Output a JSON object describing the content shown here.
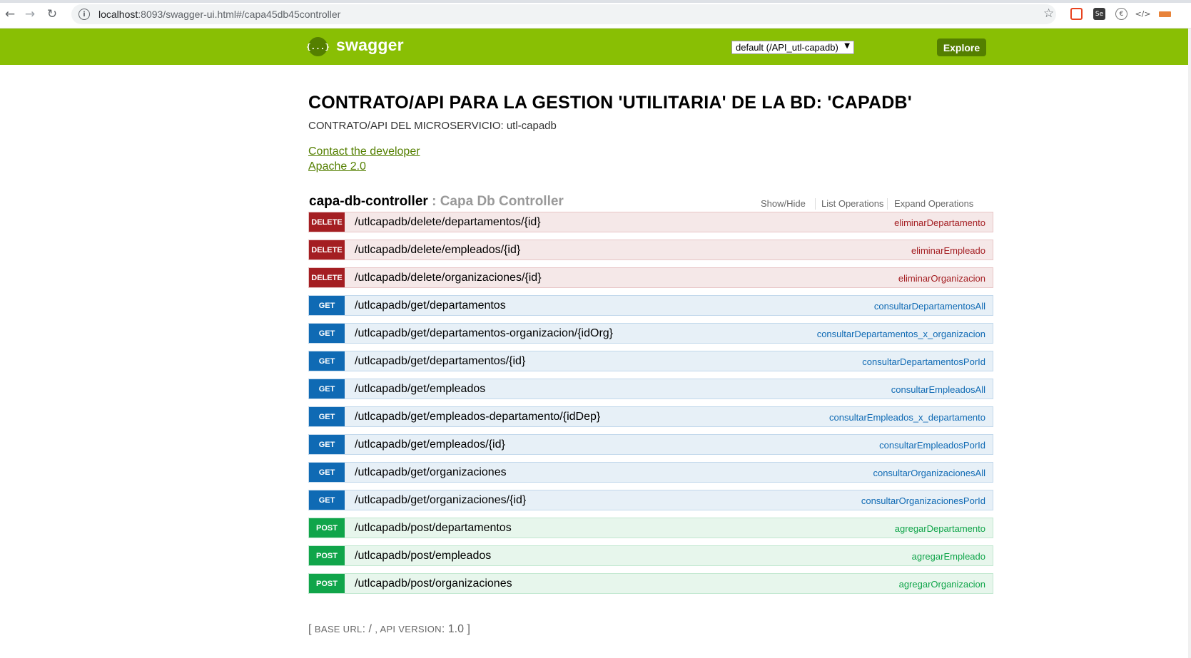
{
  "browser": {
    "url_host": "localhost",
    "url_rest": ":8093/swagger-ui.html#/capa45db45controller",
    "extensions": [
      "SE",
      "Se",
      "€",
      "</>",
      "ext"
    ]
  },
  "header": {
    "logo_text": "{...}",
    "title": "swagger",
    "api_select_value": "default (/API_utl-capadb)",
    "explore_label": "Explore"
  },
  "info": {
    "title": "CONTRATO/API PARA LA GESTION 'UTILITARIA' DE LA BD: 'CAPADB'",
    "description": "CONTRATO/API DEL MICROSERVICIO: utl-capadb",
    "contact_link": "Contact the developer",
    "license_link": "Apache 2.0"
  },
  "controller": {
    "name": "capa-db-controller",
    "separator": " : ",
    "description": "Capa Db Controller",
    "actions": [
      "Show/Hide",
      "List Operations",
      "Expand Operations"
    ]
  },
  "operations": [
    {
      "method": "DELETE",
      "path": "/utlcapadb/delete/departamentos/{id}",
      "nickname": "eliminarDepartamento"
    },
    {
      "method": "DELETE",
      "path": "/utlcapadb/delete/empleados/{id}",
      "nickname": "eliminarEmpleado"
    },
    {
      "method": "DELETE",
      "path": "/utlcapadb/delete/organizaciones/{id}",
      "nickname": "eliminarOrganizacion"
    },
    {
      "method": "GET",
      "path": "/utlcapadb/get/departamentos",
      "nickname": "consultarDepartamentosAll"
    },
    {
      "method": "GET",
      "path": "/utlcapadb/get/departamentos-organizacion/{idOrg}",
      "nickname": "consultarDepartamentos_x_organizacion"
    },
    {
      "method": "GET",
      "path": "/utlcapadb/get/departamentos/{id}",
      "nickname": "consultarDepartamentosPorId"
    },
    {
      "method": "GET",
      "path": "/utlcapadb/get/empleados",
      "nickname": "consultarEmpleadosAll"
    },
    {
      "method": "GET",
      "path": "/utlcapadb/get/empleados-departamento/{idDep}",
      "nickname": "consultarEmpleados_x_departamento"
    },
    {
      "method": "GET",
      "path": "/utlcapadb/get/empleados/{id}",
      "nickname": "consultarEmpleadosPorId"
    },
    {
      "method": "GET",
      "path": "/utlcapadb/get/organizaciones",
      "nickname": "consultarOrganizacionesAll"
    },
    {
      "method": "GET",
      "path": "/utlcapadb/get/organizaciones/{id}",
      "nickname": "consultarOrganizacionesPorId"
    },
    {
      "method": "POST",
      "path": "/utlcapadb/post/departamentos",
      "nickname": "agregarDepartamento"
    },
    {
      "method": "POST",
      "path": "/utlcapadb/post/empleados",
      "nickname": "agregarEmpleado"
    },
    {
      "method": "POST",
      "path": "/utlcapadb/post/organizaciones",
      "nickname": "agregarOrganizacion"
    }
  ],
  "footer": {
    "open_bracket": "[ ",
    "base_url_label": "BASE URL",
    "base_url_value": ": / ",
    "comma": ", ",
    "api_version_label": "API VERSION",
    "api_version_value": ": 1.0 ",
    "close_bracket": "]"
  },
  "colors": {
    "header_bg": "#89bf04",
    "delete": "#a41e22",
    "get": "#0f6ab4",
    "post": "#10a54a",
    "link": "#547f00"
  }
}
